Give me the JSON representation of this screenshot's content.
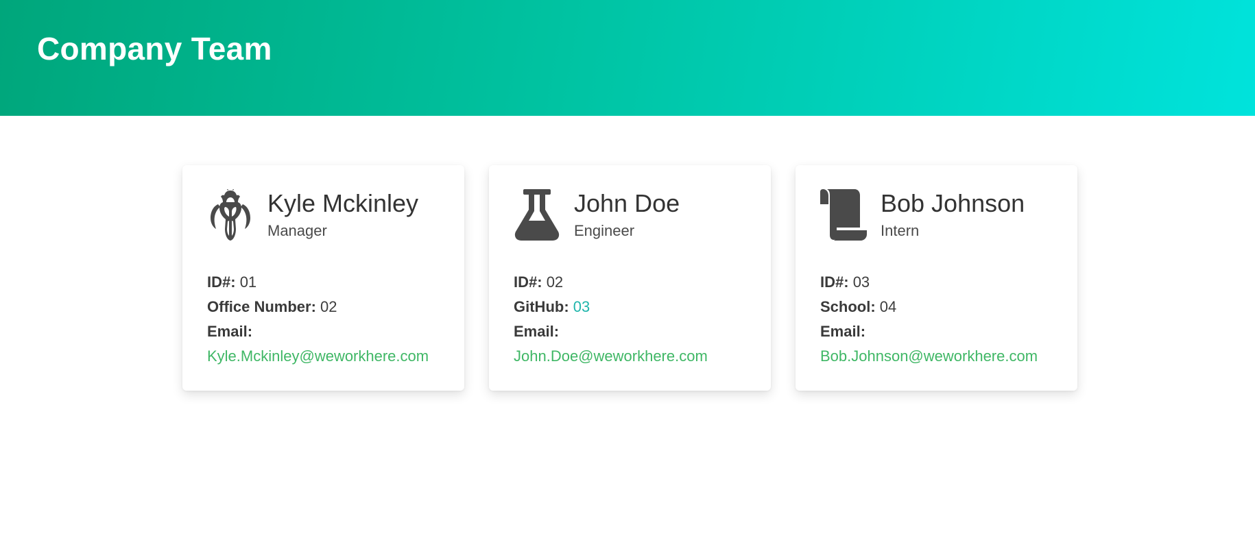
{
  "header": {
    "title": "Company Team",
    "gradient_colors": [
      "#00a67b",
      "#00e3dc"
    ]
  },
  "team": [
    {
      "name": "Kyle Mckinley",
      "role": "Manager",
      "icon": "mandalorian-icon",
      "id_label": "ID#:",
      "id_value": "01",
      "extra_label": "Office Number:",
      "extra_value": "02",
      "email_label": "Email:",
      "email": "Kyle.Mckinley@weworkhere.com"
    },
    {
      "name": "John Doe",
      "role": "Engineer",
      "icon": "flask-icon",
      "id_label": "ID#:",
      "id_value": "02",
      "extra_label": "GitHub:",
      "extra_value": "03",
      "email_label": "Email:",
      "email": "John.Doe@weworkhere.com"
    },
    {
      "name": "Bob Johnson",
      "role": "Intern",
      "icon": "scroll-icon",
      "id_label": "ID#:",
      "id_value": "03",
      "extra_label": "School:",
      "extra_value": "04",
      "email_label": "Email:",
      "email": "Bob.Johnson@weworkhere.com"
    }
  ],
  "colors": {
    "email_link": "#3fb765",
    "github_link": "#1fb5ab",
    "icon": "#4a4a4a"
  }
}
